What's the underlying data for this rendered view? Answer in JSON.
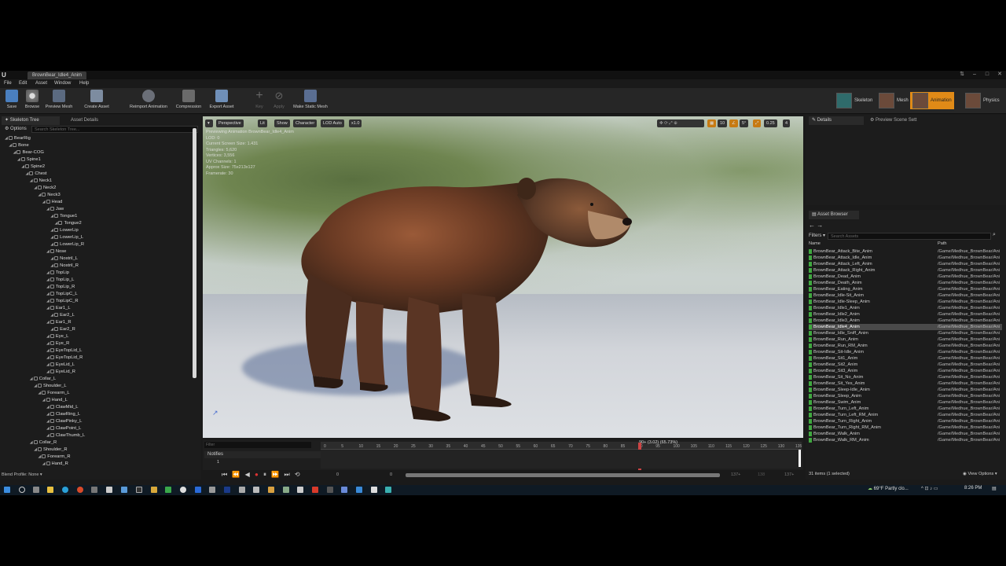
{
  "window": {
    "title": "BrownBear_Idle4_Anim",
    "tab": "BrownBear_Idle4_Anim"
  },
  "menu": [
    "File",
    "Edit",
    "Asset",
    "Window",
    "Help"
  ],
  "toolbar": {
    "save": "Save",
    "browse": "Browse",
    "preview_mesh": "Preview Mesh",
    "create_asset": "Create Asset",
    "reimport": "Reimport Animation",
    "compression": "Compression",
    "export_asset": "Export Asset",
    "key": "Key",
    "apply": "Apply",
    "make_static_mesh": "Make Static Mesh"
  },
  "modes": {
    "skeleton": "Skeleton",
    "mesh": "Mesh",
    "animation": "Animation",
    "physics": "Physics"
  },
  "left_panel": {
    "tab_skeleton_tree": "Skeleton Tree",
    "tab_asset_details": "Asset Details",
    "options": "Options",
    "search_placeholder": "Search Skeleton Tree...",
    "blend_profile": "Blend Profile: None"
  },
  "bones": [
    {
      "name": "BearRig",
      "d": 0
    },
    {
      "name": "Bone",
      "d": 1
    },
    {
      "name": "Bear-COG",
      "d": 2
    },
    {
      "name": "Spine1",
      "d": 3
    },
    {
      "name": "Spine2",
      "d": 4
    },
    {
      "name": "Chest",
      "d": 5
    },
    {
      "name": "Neck1",
      "d": 6
    },
    {
      "name": "Neck2",
      "d": 7
    },
    {
      "name": "Neck3",
      "d": 8
    },
    {
      "name": "Head",
      "d": 9
    },
    {
      "name": "Jaw",
      "d": 10
    },
    {
      "name": "Tongue1",
      "d": 11
    },
    {
      "name": "Tongue2",
      "d": 12
    },
    {
      "name": "LowerLip",
      "d": 11
    },
    {
      "name": "LowerLip_L",
      "d": 11
    },
    {
      "name": "LowerLip_R",
      "d": 11
    },
    {
      "name": "Nose",
      "d": 10
    },
    {
      "name": "Nostril_L",
      "d": 11
    },
    {
      "name": "Nostril_R",
      "d": 11
    },
    {
      "name": "TopLip",
      "d": 10
    },
    {
      "name": "TopLip_L",
      "d": 10
    },
    {
      "name": "TopLip_R",
      "d": 10
    },
    {
      "name": "TopLipC_L",
      "d": 10
    },
    {
      "name": "TopLipC_R",
      "d": 10
    },
    {
      "name": "Ear1_L",
      "d": 10
    },
    {
      "name": "Ear2_L",
      "d": 11
    },
    {
      "name": "Ear1_R",
      "d": 10
    },
    {
      "name": "Ear2_R",
      "d": 11
    },
    {
      "name": "Eye_L",
      "d": 10
    },
    {
      "name": "Eye_R",
      "d": 10
    },
    {
      "name": "EyeTopLid_L",
      "d": 10
    },
    {
      "name": "EyeTopLid_R",
      "d": 10
    },
    {
      "name": "EyeLid_L",
      "d": 10
    },
    {
      "name": "EyeLid_R",
      "d": 10
    },
    {
      "name": "Collar_L",
      "d": 6
    },
    {
      "name": "Shoulder_L",
      "d": 7
    },
    {
      "name": "Forearm_L",
      "d": 8
    },
    {
      "name": "Hand_L",
      "d": 9
    },
    {
      "name": "ClawMid_L",
      "d": 10
    },
    {
      "name": "ClawRing_L",
      "d": 10
    },
    {
      "name": "ClawPinky_L",
      "d": 10
    },
    {
      "name": "ClawPoint_L",
      "d": 10
    },
    {
      "name": "ClawThumb_L",
      "d": 10
    },
    {
      "name": "Collar_R",
      "d": 6
    },
    {
      "name": "Shoulder_R",
      "d": 7
    },
    {
      "name": "Forearm_R",
      "d": 8
    },
    {
      "name": "Hand_R",
      "d": 9
    }
  ],
  "viewport": {
    "buttons": {
      "menu": "▾",
      "perspective": "Perspective",
      "lit": "Lit",
      "show": "Show",
      "character": "Character",
      "lod": "LOD Auto",
      "speed": "x1.0"
    },
    "right_values": {
      "grid": "10",
      "angle": "5°",
      "scale": "0.25",
      "cam": "4"
    },
    "info": [
      "Previewing Animation BrownBear_Idle4_Anim",
      "LOD: 0",
      "Current Screen Size: 1.431",
      "Triangles: 5,620",
      "Vertices: 3,556",
      "UV Channels: 1",
      "Approx Size: 75x213x127",
      "Framerate: 30"
    ]
  },
  "timeline": {
    "filter_placeholder": "Filter",
    "notifies": "Notifies",
    "track_index": "1",
    "playhead_label": "90+ (3.02) (65.73%)",
    "ticks": [
      "0",
      "5",
      "10",
      "15",
      "20",
      "25",
      "30",
      "35",
      "40",
      "45",
      "50",
      "55",
      "60",
      "65",
      "70",
      "75",
      "80",
      "85",
      "90",
      "95",
      "100",
      "105",
      "110",
      "115",
      "120",
      "125",
      "130",
      "135"
    ],
    "start": "0",
    "start2": "0",
    "end": "137+",
    "end2": "137+",
    "mid": "138"
  },
  "details": {
    "tab": "Details",
    "preview_tab": "Preview Scene Sett"
  },
  "asset_browser": {
    "tab": "Asset Browser",
    "filters": "Filters",
    "search_placeholder": "Search Assets",
    "col_name": "Name",
    "col_path": "Path",
    "items": [
      "BrownBear_Attack_Bite_Anim",
      "BrownBear_Attack_Idle_Anim",
      "BrownBear_Attack_Left_Anim",
      "BrownBear_Attack_Right_Anim",
      "BrownBear_Dead_Anim",
      "BrownBear_Death_Anim",
      "BrownBear_Eating_Anim",
      "BrownBear_Idle-Sit_Anim",
      "BrownBear_Idle-Sleep_Anim",
      "BrownBear_Idle1_Anim",
      "BrownBear_Idle2_Anim",
      "BrownBear_Idle3_Anim",
      "BrownBear_Idle4_Anim",
      "BrownBear_Idle_Sniff_Anim",
      "BrownBear_Run_Anim",
      "BrownBear_Run_RM_Anim",
      "BrownBear_Sit-Idle_Anim",
      "BrownBear_Sit1_Anim",
      "BrownBear_Sit2_Anim",
      "BrownBear_Sit3_Anim",
      "BrownBear_Sit_No_Anim",
      "BrownBear_Sit_Yes_Anim",
      "BrownBear_Sleep-Idle_Anim",
      "BrownBear_Sleep_Anim",
      "BrownBear_Swim_Anim",
      "BrownBear_Turn_Left_Anim",
      "BrownBear_Turn_Left_RM_Anim",
      "BrownBear_Turn_Right_Anim",
      "BrownBear_Turn_Right_RM_Anim",
      "BrownBear_Walk_Anim",
      "BrownBear_Walk_RM_Anim"
    ],
    "path": "/Game/Medhue_BrownBear/Ani",
    "selected_index": 12,
    "count": "31 items (1 selected)",
    "view_options": "View Options"
  },
  "taskbar": {
    "weather": "69°F  Partly clo...",
    "time": "8:26 PM"
  },
  "colors": {
    "accent": "#e08a17",
    "panel": "#1c1c1c",
    "selection": "#4a4a4a"
  }
}
